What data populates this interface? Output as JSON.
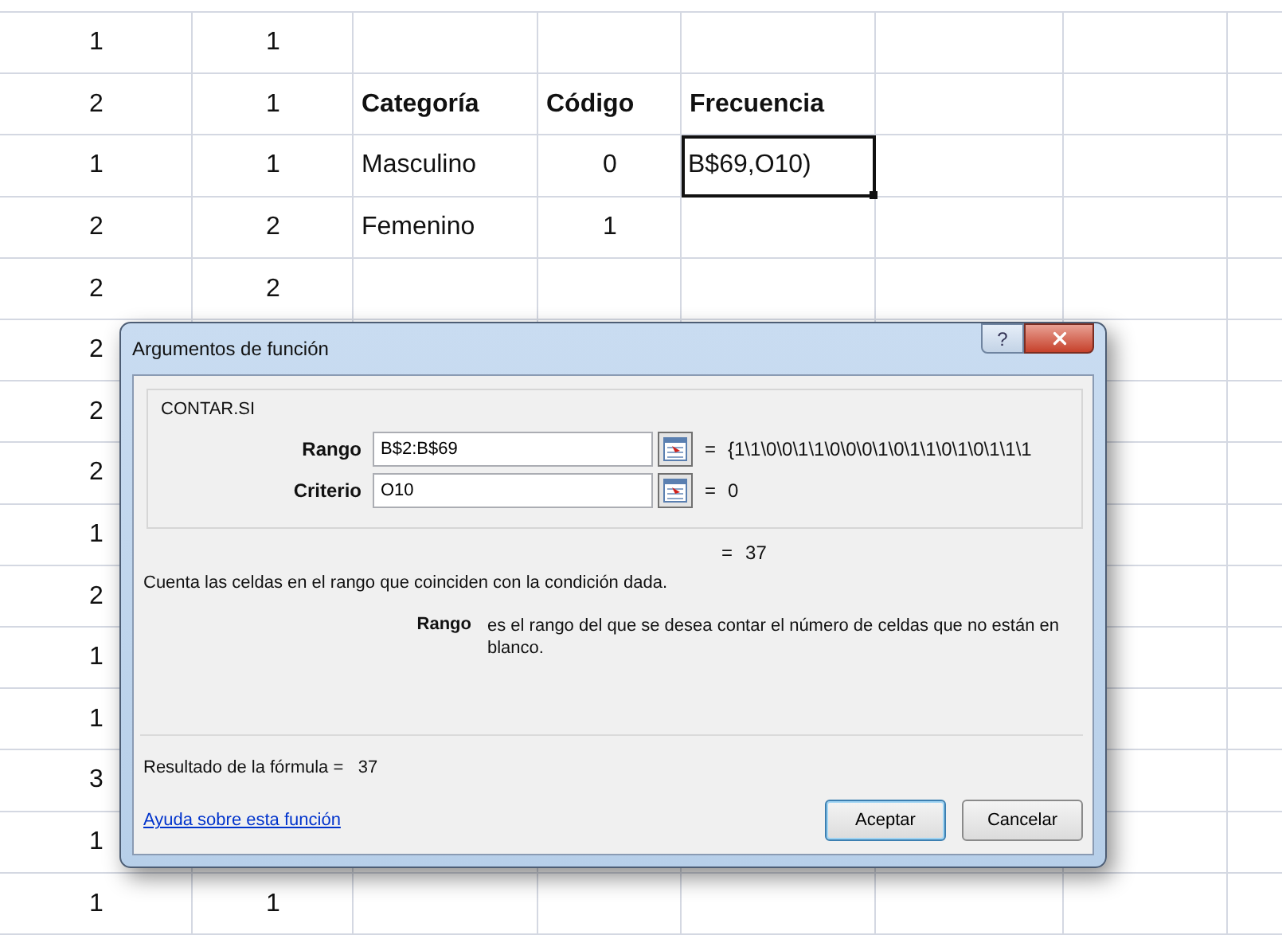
{
  "sheet": {
    "rows": [
      {
        "cells": {
          "column_1": {
            "text": "1",
            "kind": "number"
          },
          "column_2": {
            "text": "1",
            "kind": "number"
          }
        }
      },
      {
        "cells": {
          "column_1": {
            "text": "2",
            "kind": "number"
          },
          "column_2": {
            "text": "1",
            "kind": "number"
          },
          "column_3": {
            "text": "Categoría",
            "kind": "header"
          },
          "column_4": {
            "text": "Código",
            "kind": "header"
          },
          "column_5": {
            "text": "Frecuencia",
            "kind": "header"
          }
        }
      },
      {
        "cells": {
          "column_1": {
            "text": "1",
            "kind": "number"
          },
          "column_2": {
            "text": "1",
            "kind": "number"
          },
          "column_3": {
            "text": "Masculino",
            "kind": "text"
          },
          "column_4": {
            "text": "0",
            "kind": "number"
          },
          "column_5": {
            "text": "B$69,O10)",
            "kind": "editing"
          }
        }
      },
      {
        "cells": {
          "column_1": {
            "text": "2",
            "kind": "number"
          },
          "column_2": {
            "text": "2",
            "kind": "number"
          },
          "column_3": {
            "text": "Femenino",
            "kind": "text"
          },
          "column_4": {
            "text": "1",
            "kind": "number"
          }
        }
      },
      {
        "cells": {
          "column_1": {
            "text": "2",
            "kind": "number"
          },
          "column_2": {
            "text": "2",
            "kind": "number"
          }
        }
      },
      {
        "cells": {
          "column_1": {
            "text": "2",
            "kind": "number"
          }
        }
      },
      {
        "cells": {
          "column_1": {
            "text": "2",
            "kind": "number"
          }
        }
      },
      {
        "cells": {
          "column_1": {
            "text": "2",
            "kind": "number"
          }
        }
      },
      {
        "cells": {
          "column_1": {
            "text": "1",
            "kind": "number"
          }
        }
      },
      {
        "cells": {
          "column_1": {
            "text": "2",
            "kind": "number"
          }
        }
      },
      {
        "cells": {
          "column_1": {
            "text": "1",
            "kind": "number"
          }
        }
      },
      {
        "cells": {
          "column_1": {
            "text": "1",
            "kind": "number"
          }
        }
      },
      {
        "cells": {
          "column_1": {
            "text": "3",
            "kind": "number"
          }
        }
      },
      {
        "cells": {
          "column_1": {
            "text": "1",
            "kind": "number"
          }
        }
      },
      {
        "cells": {
          "column_1": {
            "text": "1",
            "kind": "number"
          },
          "column_2": {
            "text": "1",
            "kind": "number"
          }
        }
      }
    ]
  },
  "dialog": {
    "title": "Argumentos de función",
    "help_button": "?",
    "function_name": "CONTAR.SI",
    "arguments": [
      {
        "label": "Rango",
        "value": "B$2:B$69",
        "equals": "=",
        "result": "{1\\1\\0\\0\\1\\1\\0\\0\\0\\1\\0\\1\\1\\0\\1\\0\\1\\1\\1"
      },
      {
        "label": "Criterio",
        "value": "O10",
        "equals": "=",
        "result": "0"
      }
    ],
    "total": {
      "equals": "=",
      "result": "37"
    },
    "description": "Cuenta las celdas en el rango que coinciden con la condición dada.",
    "argument_help": {
      "name": "Rango",
      "text": "es el rango del que se desea contar el número de celdas que no están en blanco."
    },
    "formula_result": {
      "label": "Resultado de la fórmula =",
      "value": "37"
    },
    "help_link": "Ayuda sobre esta función",
    "buttons": [
      {
        "label": "Aceptar",
        "default": true
      },
      {
        "label": "Cancelar",
        "default": false
      }
    ]
  }
}
